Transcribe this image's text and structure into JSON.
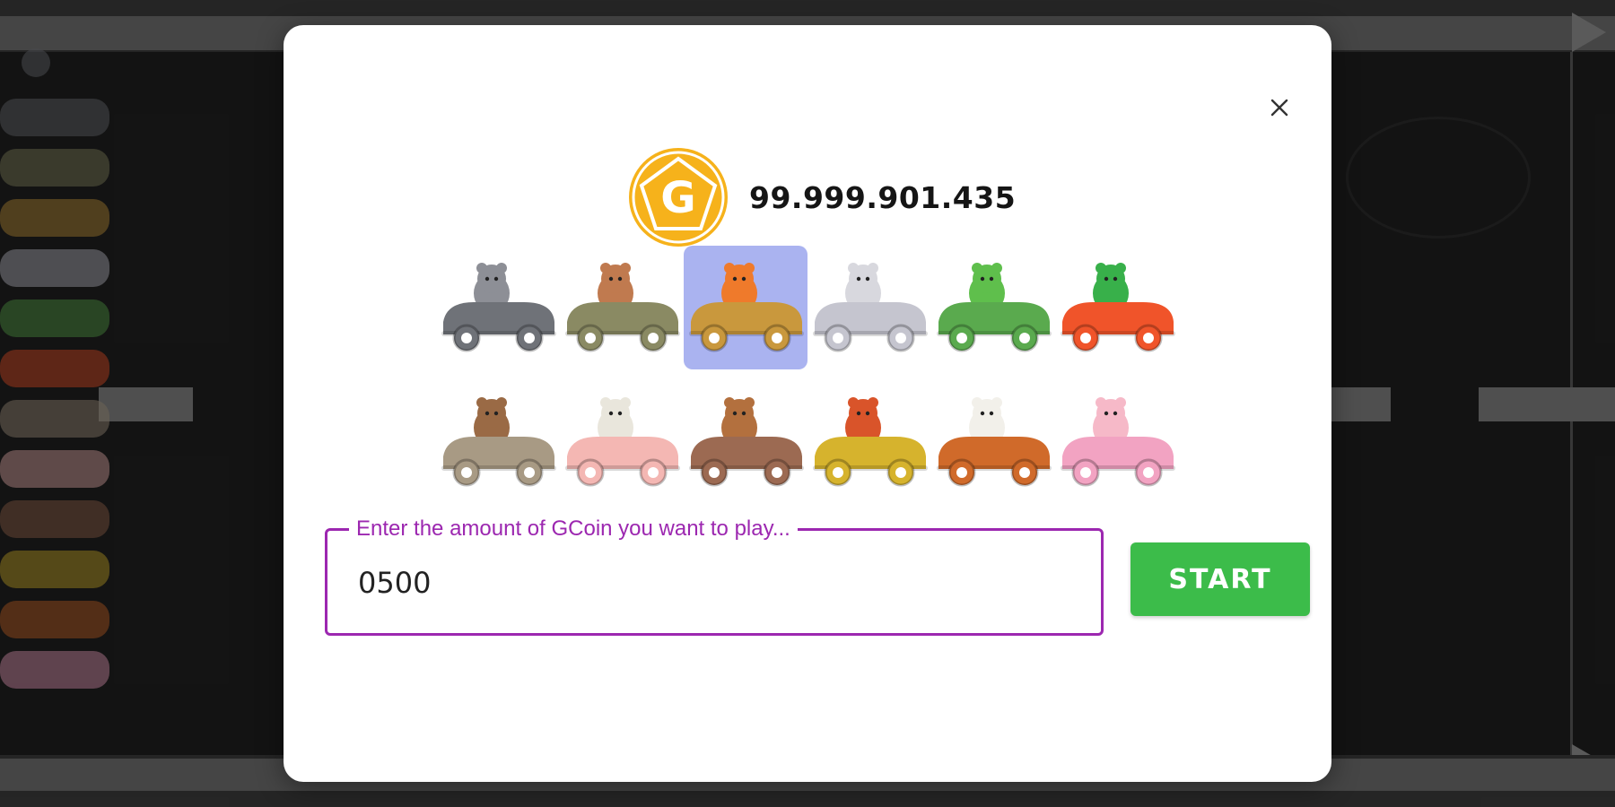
{
  "balance": {
    "coin_icon": "gcoin-icon",
    "coin_letter": "G",
    "amount": "99.999.901.435"
  },
  "cars": [
    {
      "animal": "rat",
      "car_color": "#6f7278",
      "selected": false
    },
    {
      "animal": "ox",
      "car_color": "#8a8a63",
      "selected": false
    },
    {
      "animal": "tiger",
      "car_color": "#c9983d",
      "selected": true
    },
    {
      "animal": "cat",
      "car_color": "#c5c5cf",
      "selected": false
    },
    {
      "animal": "dragon",
      "car_color": "#5aaa4e",
      "selected": false
    },
    {
      "animal": "snake",
      "car_color": "#f0542a",
      "selected": false
    },
    {
      "animal": "horse",
      "car_color": "#a89a84",
      "selected": false
    },
    {
      "animal": "goat",
      "car_color": "#f4b7b3",
      "selected": false
    },
    {
      "animal": "monkey",
      "car_color": "#9c6a52",
      "selected": false
    },
    {
      "animal": "rooster",
      "car_color": "#d6b32d",
      "selected": false
    },
    {
      "animal": "dog",
      "car_color": "#d06a2a",
      "selected": false
    },
    {
      "animal": "pig",
      "car_color": "#f2a3c2",
      "selected": false
    }
  ],
  "amount_field": {
    "label": "Enter the amount of GCoin you want to play...",
    "value": "0500"
  },
  "start_button": {
    "label": "START"
  },
  "colors": {
    "accent_purple": "#9c27b0",
    "start_green": "#3cbc4a",
    "selected_tile": "#aab3f0",
    "coin_gold": "#f6b21b"
  }
}
